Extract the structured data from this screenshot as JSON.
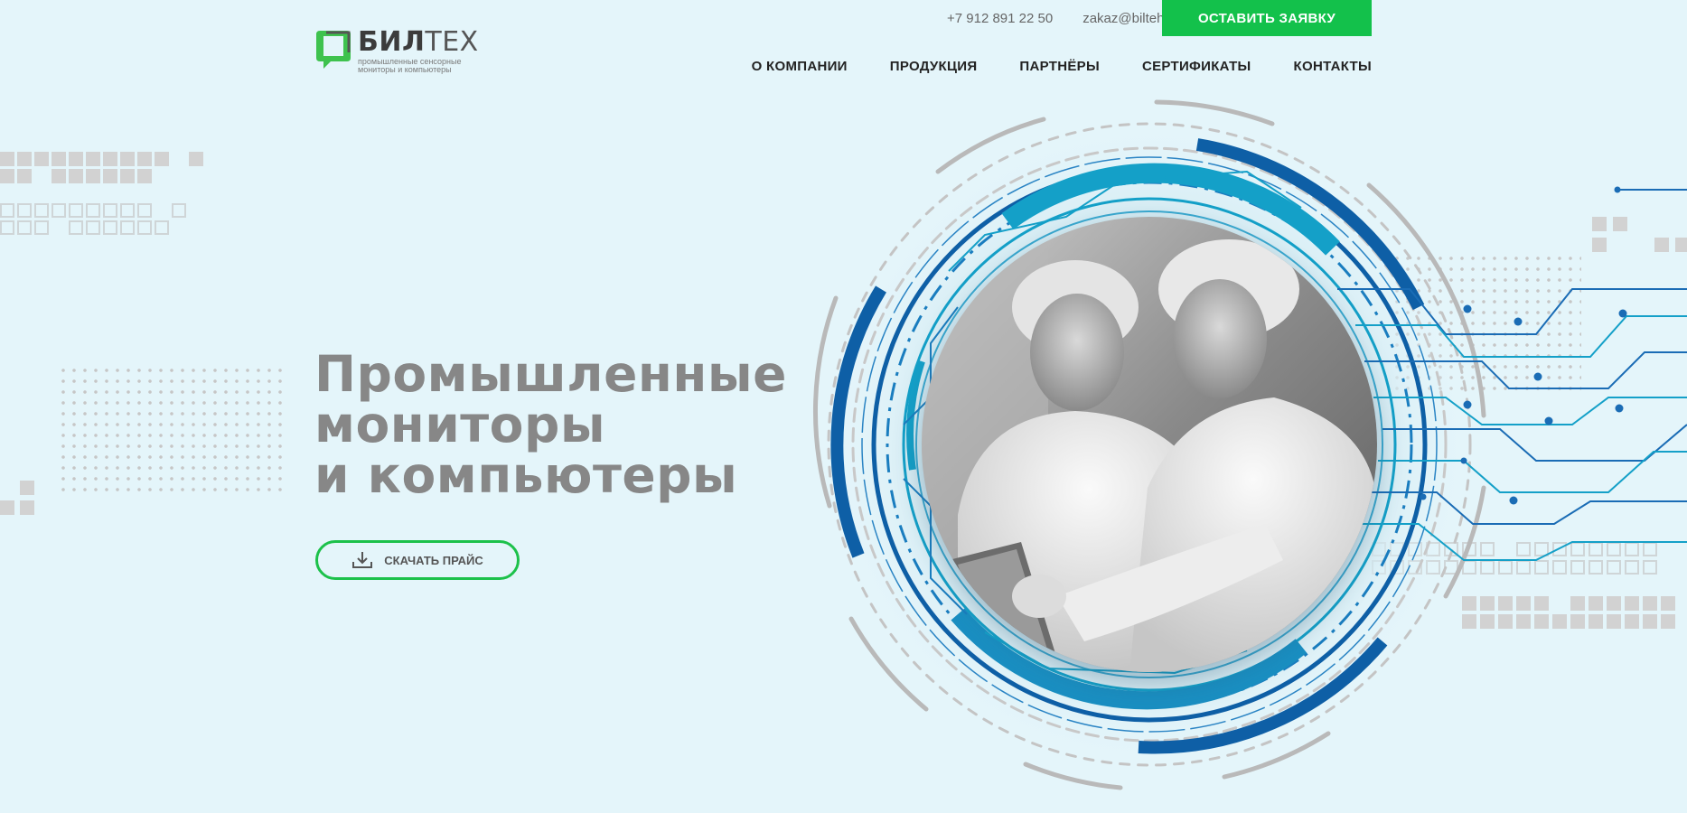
{
  "header": {
    "logo": {
      "word_bold": "БИЛ",
      "word_light": "ТЕХ",
      "tagline": "промышленные сенсорные мониторы и компьютеры"
    },
    "phone": "+7 912 891 22 50",
    "email": "zakaz@bilteh.ru",
    "cta_label": "ОСТАВИТЬ ЗАЯВКУ",
    "nav": [
      {
        "label": "О КОМПАНИИ"
      },
      {
        "label": "ПРОДУКЦИЯ"
      },
      {
        "label": "ПАРТНЁРЫ"
      },
      {
        "label": "СЕРТИФИКАТЫ"
      },
      {
        "label": "КОНТАКТЫ"
      }
    ]
  },
  "hero": {
    "title_lines": [
      "Промышленные",
      "мониторы",
      "и компьютеры"
    ],
    "price_button_label": "СКАЧАТЬ ПРАЙС",
    "price_button_icon": "download-icon"
  },
  "colors": {
    "background": "#e4f5fa",
    "accent_green": "#13c14b",
    "title_gray": "#878787",
    "ring_blue_dark": "#0e5fa6",
    "ring_blue_light": "#14a0c8"
  }
}
